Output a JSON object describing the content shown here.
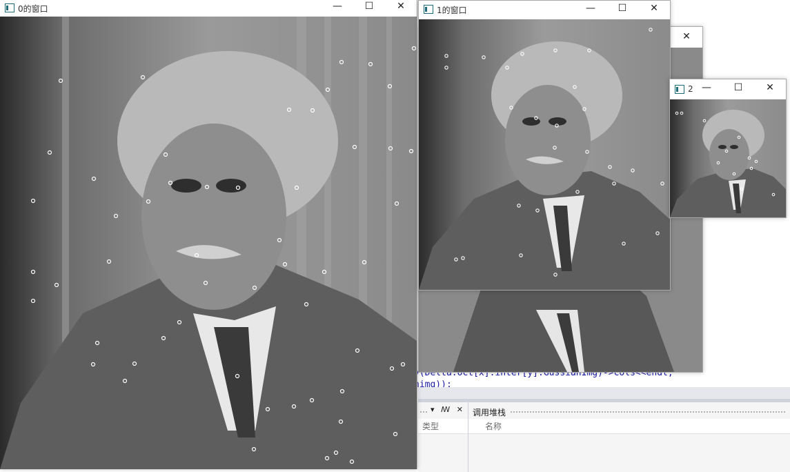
{
  "ide": {
    "code_line_1": "v(Delta.oct[x].inter[y].GussianImg)->cols<<endl;",
    "code_line_2": "nimg));",
    "left_panel": {
      "tools": "▾ ꟿ ✕",
      "column": "类型"
    },
    "right_panel": {
      "title": "调用堆栈",
      "column": "名称"
    }
  },
  "windows": [
    {
      "title": "0的窗口",
      "min": "—",
      "max": "☐",
      "close": "✕"
    },
    {
      "title": "1的窗口",
      "min": "—",
      "max": "☐",
      "close": "✕"
    },
    {
      "title": "2",
      "min": "—",
      "max": "☐",
      "close": "✕"
    },
    {
      "title": "",
      "close": "✕"
    }
  ],
  "colors": {
    "frame": "#aaaaaa",
    "keypoint": "#ffffff",
    "ide_blue": "#1a1aa6",
    "ide_red": "#a31515"
  }
}
